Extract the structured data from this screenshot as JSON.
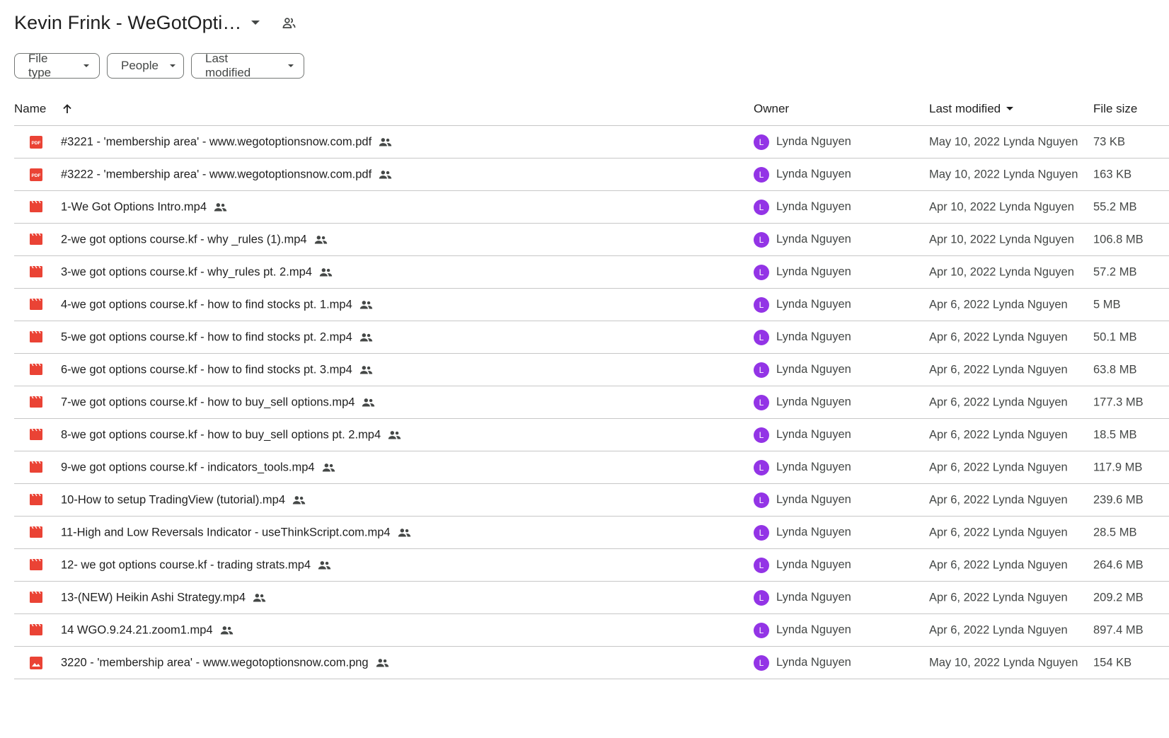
{
  "header": {
    "folder_title": "Kevin Frink - WeGotOpti…"
  },
  "filters": [
    {
      "label": "File type"
    },
    {
      "label": "People"
    },
    {
      "label": "Last modified"
    }
  ],
  "columns": {
    "name": "Name",
    "owner": "Owner",
    "last_modified": "Last modified",
    "file_size": "File size"
  },
  "files": [
    {
      "name": "#3221 - 'membership area' - www.wegotoptionsnow.com.pdf",
      "type": "pdf",
      "owner": "Lynda Nguyen",
      "owner_initial": "L",
      "modified": "May 10, 2022 Lynda Nguyen",
      "size": "73 KB"
    },
    {
      "name": "#3222 - 'membership area' - www.wegotoptionsnow.com.pdf",
      "type": "pdf",
      "owner": "Lynda Nguyen",
      "owner_initial": "L",
      "modified": "May 10, 2022 Lynda Nguyen",
      "size": "163 KB"
    },
    {
      "name": "1-We Got Options Intro.mp4",
      "type": "video",
      "owner": "Lynda Nguyen",
      "owner_initial": "L",
      "modified": "Apr 10, 2022 Lynda Nguyen",
      "size": "55.2 MB"
    },
    {
      "name": "2-we got options course.kf - why _rules (1).mp4",
      "type": "video",
      "owner": "Lynda Nguyen",
      "owner_initial": "L",
      "modified": "Apr 10, 2022 Lynda Nguyen",
      "size": "106.8 MB"
    },
    {
      "name": "3-we got options course.kf - why_rules pt. 2.mp4",
      "type": "video",
      "owner": "Lynda Nguyen",
      "owner_initial": "L",
      "modified": "Apr 10, 2022 Lynda Nguyen",
      "size": "57.2 MB"
    },
    {
      "name": "4-we got options course.kf - how to find stocks pt. 1.mp4",
      "type": "video",
      "owner": "Lynda Nguyen",
      "owner_initial": "L",
      "modified": "Apr 6, 2022 Lynda Nguyen",
      "size": "5 MB"
    },
    {
      "name": "5-we got options course.kf - how to find stocks pt. 2.mp4",
      "type": "video",
      "owner": "Lynda Nguyen",
      "owner_initial": "L",
      "modified": "Apr 6, 2022 Lynda Nguyen",
      "size": "50.1 MB"
    },
    {
      "name": "6-we got options course.kf - how to find stocks pt. 3.mp4",
      "type": "video",
      "owner": "Lynda Nguyen",
      "owner_initial": "L",
      "modified": "Apr 6, 2022 Lynda Nguyen",
      "size": "63.8 MB"
    },
    {
      "name": "7-we got options course.kf - how to buy_sell options.mp4",
      "type": "video",
      "owner": "Lynda Nguyen",
      "owner_initial": "L",
      "modified": "Apr 6, 2022 Lynda Nguyen",
      "size": "177.3 MB"
    },
    {
      "name": "8-we got options course.kf - how to buy_sell options pt. 2.mp4",
      "type": "video",
      "owner": "Lynda Nguyen",
      "owner_initial": "L",
      "modified": "Apr 6, 2022 Lynda Nguyen",
      "size": "18.5 MB"
    },
    {
      "name": "9-we got options course.kf - indicators_tools.mp4",
      "type": "video",
      "owner": "Lynda Nguyen",
      "owner_initial": "L",
      "modified": "Apr 6, 2022 Lynda Nguyen",
      "size": "117.9 MB"
    },
    {
      "name": "10-How to setup TradingView (tutorial).mp4",
      "type": "video",
      "owner": "Lynda Nguyen",
      "owner_initial": "L",
      "modified": "Apr 6, 2022 Lynda Nguyen",
      "size": "239.6 MB"
    },
    {
      "name": "11-High and Low Reversals Indicator - useThinkScript.com.mp4",
      "type": "video",
      "owner": "Lynda Nguyen",
      "owner_initial": "L",
      "modified": "Apr 6, 2022 Lynda Nguyen",
      "size": "28.5 MB"
    },
    {
      "name": "12- we got options course.kf - trading strats.mp4",
      "type": "video",
      "owner": "Lynda Nguyen",
      "owner_initial": "L",
      "modified": "Apr 6, 2022 Lynda Nguyen",
      "size": "264.6 MB"
    },
    {
      "name": "13-(NEW) Heikin Ashi Strategy.mp4",
      "type": "video",
      "owner": "Lynda Nguyen",
      "owner_initial": "L",
      "modified": "Apr 6, 2022 Lynda Nguyen",
      "size": "209.2 MB"
    },
    {
      "name": "14 WGO.9.24.21.zoom1.mp4",
      "type": "video",
      "owner": "Lynda Nguyen",
      "owner_initial": "L",
      "modified": "Apr 6, 2022 Lynda Nguyen",
      "size": "897.4 MB"
    },
    {
      "name": "3220 - 'membership area' - www.wegotoptionsnow.com.png",
      "type": "image",
      "owner": "Lynda Nguyen",
      "owner_initial": "L",
      "modified": "May 10, 2022 Lynda Nguyen",
      "size": "154 KB"
    }
  ],
  "colors": {
    "file_icon_red": "#ea4335",
    "avatar_purple": "#9334e6",
    "divider": "#c7c7c7"
  },
  "icons": {
    "folder_shared": "people-icon",
    "row_shared": "people-icon",
    "pdf": "pdf-icon",
    "video": "video-icon",
    "image": "image-icon"
  }
}
